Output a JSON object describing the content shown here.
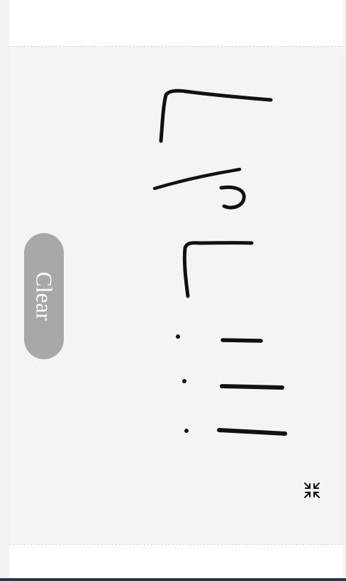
{
  "controls": {
    "clear_label": "Clear",
    "collapse_icon": "collapse-arrows-icon"
  },
  "colors": {
    "ink": "#111111",
    "canvas_background": "#f3f4f4",
    "clear_button": "#a8a8a8",
    "clear_text": "#ffffff"
  }
}
